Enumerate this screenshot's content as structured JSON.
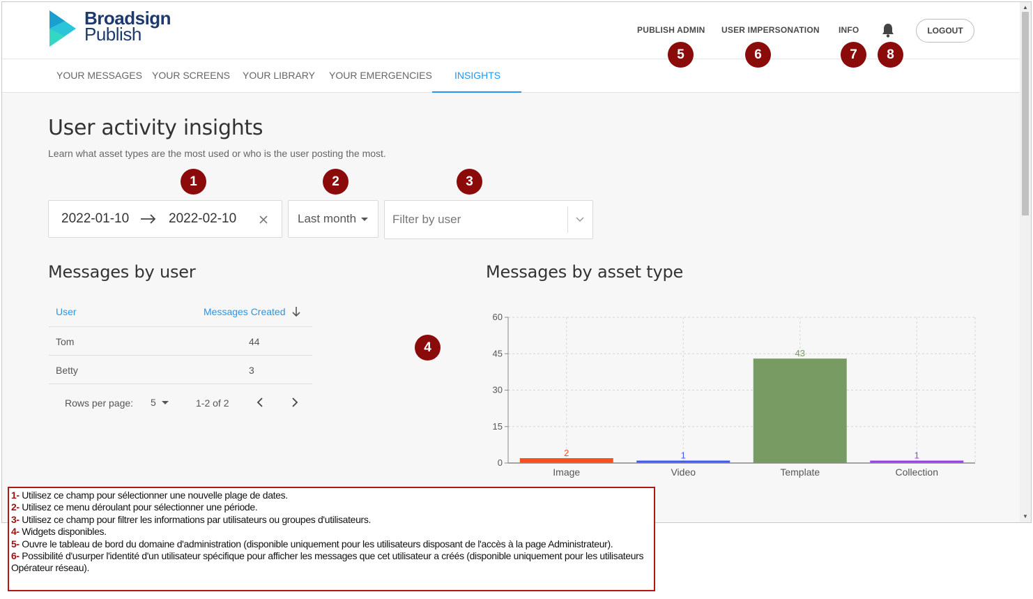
{
  "app": {
    "logo_line1": "Broadsign",
    "logo_line2": "Publish",
    "brand_colors": {
      "logo_teal": "#2bc4d9",
      "logo_blue": "#1d3a6e",
      "accent": "#2196f3",
      "marker": "#8b0b0b"
    }
  },
  "header": {
    "publish_admin": "PUBLISH ADMIN",
    "user_impersonation": "USER IMPERSONATION",
    "info": "INFO",
    "bell_icon": "bell-icon",
    "logout": "LOGOUT"
  },
  "tabs": [
    {
      "label": "YOUR MESSAGES"
    },
    {
      "label": "YOUR SCREENS"
    },
    {
      "label": "YOUR LIBRARY"
    },
    {
      "label": "YOUR EMERGENCIES"
    },
    {
      "label": "INSIGHTS",
      "active": true
    }
  ],
  "page": {
    "title": "User activity insights",
    "subtitle": "Learn what asset types are the most used or who is the user posting the most."
  },
  "filters": {
    "date_from": "2022-01-10",
    "date_to": "2022-02-10",
    "period": "Last month",
    "user_placeholder": "Filter by user"
  },
  "markers": [
    "1",
    "2",
    "3",
    "4",
    "5",
    "6",
    "7",
    "8"
  ],
  "messages_by_user": {
    "title": "Messages by user",
    "col_user": "User",
    "col_messages": "Messages Created",
    "rows": [
      {
        "user": "Tom",
        "count": "44"
      },
      {
        "user": "Betty",
        "count": "3"
      }
    ],
    "rows_per_page_label": "Rows per page:",
    "rows_per_page": "5",
    "range": "1-2 of 2"
  },
  "messages_by_asset": {
    "title": "Messages by asset type"
  },
  "chart_data": {
    "type": "bar",
    "title": "Messages by asset type",
    "categories": [
      "Image",
      "Video",
      "Template",
      "Collection"
    ],
    "values": [
      2,
      1,
      43,
      1
    ],
    "colors": [
      "#f4511e",
      "#3d5afe",
      "#789b63",
      "#9c3df0"
    ],
    "data_labels": [
      "2",
      "1",
      "43",
      "1"
    ],
    "yticks": [
      0,
      15,
      30,
      45,
      60
    ],
    "ylim": [
      0,
      60
    ],
    "grid": true,
    "xlabel": "",
    "ylabel": ""
  },
  "legend": [
    {
      "num": "1-",
      "text": " Utilisez ce champ pour sélectionner une nouvelle plage de dates."
    },
    {
      "num": "2-",
      "text": " Utilisez ce menu déroulant pour sélectionner une période."
    },
    {
      "num": "3-",
      "text": " Utilisez ce champ pour filtrer les informations par utilisateurs ou groupes d'utilisateurs."
    },
    {
      "num": "4-",
      "text": " Widgets disponibles."
    },
    {
      "num": "5-",
      "text": " Ouvre le tableau de bord du domaine d'administration (disponible uniquement pour les utilisateurs disposant de l'accès à la page Administrateur)."
    },
    {
      "num": "6-",
      "text": " Possibilité d'usurper l'identité d'un utilisateur spécifique pour afficher les messages que cet utilisateur a créés (disponible uniquement pour les utilisateurs Opérateur réseau)."
    }
  ]
}
